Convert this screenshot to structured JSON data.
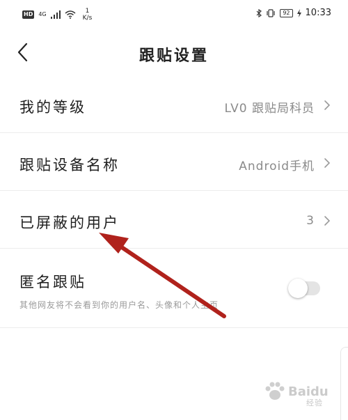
{
  "statusbar": {
    "hd": "HD",
    "network": "4G",
    "speed_value": "1",
    "speed_unit": "K/s",
    "battery": "92",
    "time": "10:33"
  },
  "header": {
    "title": "跟贴设置"
  },
  "rows": [
    {
      "label": "我的等级",
      "value": "LV0 跟贴局科员"
    },
    {
      "label": "跟贴设备名称",
      "value": "Android手机"
    },
    {
      "label": "已屏蔽的用户",
      "value": "3"
    }
  ],
  "anonymous": {
    "label": "匿名跟贴",
    "description": "其他网友将不会看到你的用户名、头像和个人主页",
    "enabled": false
  },
  "watermark": {
    "brand": "Baidu",
    "sub": "经验"
  },
  "colors": {
    "arrow": "#b0221c",
    "toggle_track": "#e4e4e4",
    "value_text": "#8a8a8a"
  }
}
